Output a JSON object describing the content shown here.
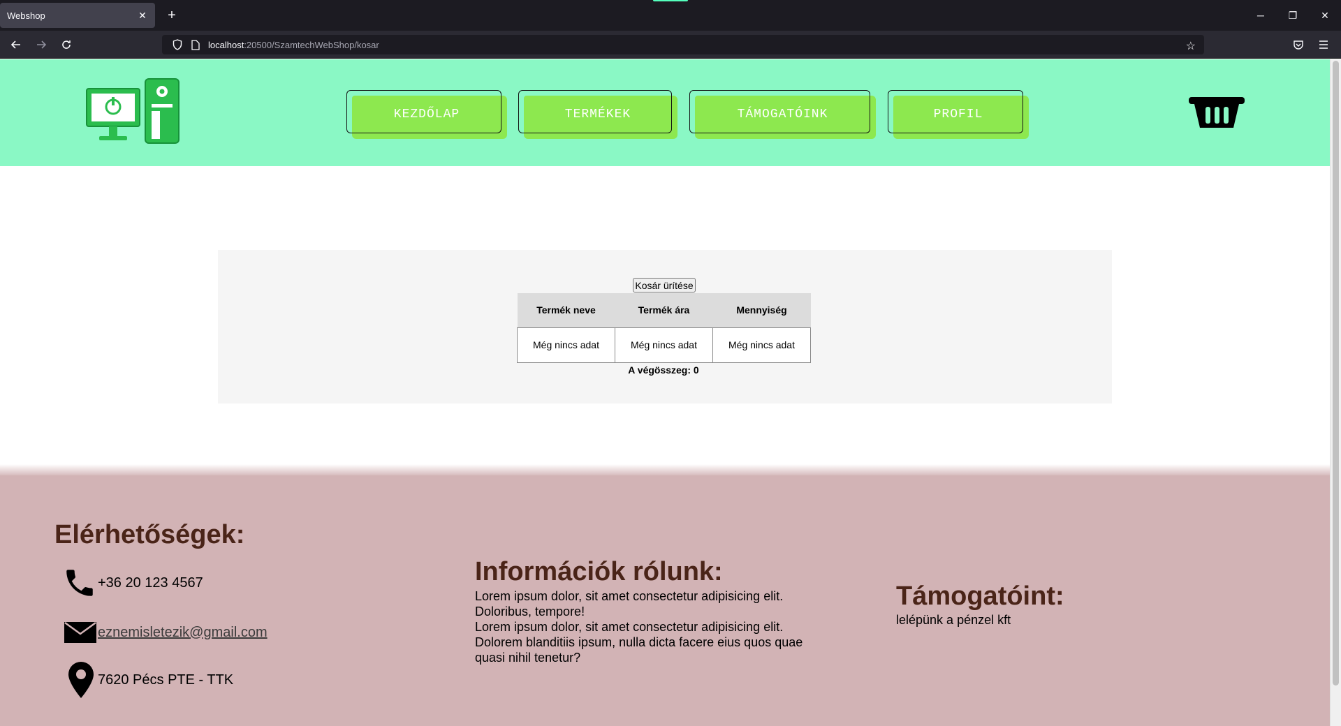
{
  "browser": {
    "tab_title": "Webshop",
    "tab_close": "✕",
    "new_tab": "+",
    "url_host": "localhost",
    "url_rest": ":20500/SzamtechWebShop/kosar",
    "window_controls": {
      "minimize": "─",
      "restore": "❐",
      "close": "✕"
    }
  },
  "header": {
    "menu": [
      {
        "label": "KEZDŐLAP"
      },
      {
        "label": "TERMÉKEK"
      },
      {
        "label": "TÁMOGATÓINK"
      },
      {
        "label": "PROFIL"
      }
    ],
    "logo_icon": "computer-logo-icon",
    "cart_icon": "basket-icon"
  },
  "cart": {
    "empty_button": "Kosár ürítése",
    "columns": [
      "Termék neve",
      "Termék ára",
      "Mennyiség"
    ],
    "rows": [
      [
        "Még nincs adat",
        "Még nincs adat",
        "Még nincs adat"
      ]
    ],
    "total_label": "A végösszeg: 0"
  },
  "footer": {
    "contacts": {
      "title": "Elérhetőségek:",
      "phone": "+36 20 123 4567",
      "email": "eznemisletezik@gmail.com",
      "address": "7620 Pécs PTE - TTK"
    },
    "about": {
      "title": "Információk rólunk:",
      "lines": [
        "Lorem ipsum dolor, sit amet consectetur adipisicing elit.",
        "Doloribus, tempore!",
        "Lorem ipsum dolor, sit amet consectetur adipisicing elit.",
        "Dolorem blanditiis ipsum, nulla dicta facere eius quos quae",
        "quasi nihil tenetur?"
      ]
    },
    "sponsors": {
      "title": "Támogatóint:",
      "text": "lelépünk a pénzel kft"
    }
  },
  "colors": {
    "header_bg": "#8af8c5",
    "button_green": "#8de84f",
    "footer_bg": "#d2b3b5",
    "footer_heading": "#4a2418"
  }
}
